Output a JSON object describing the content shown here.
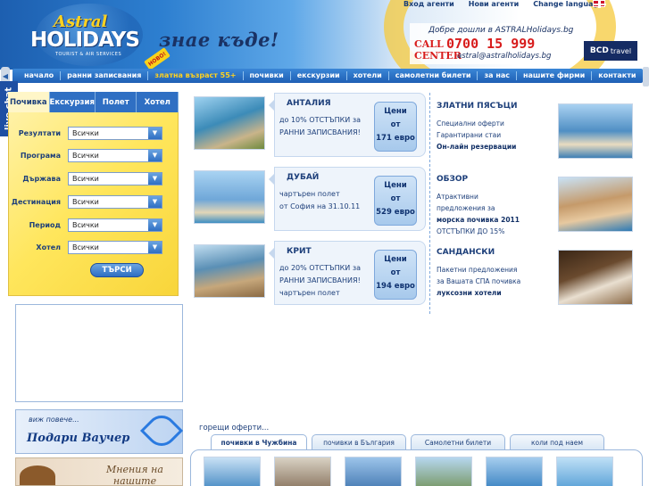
{
  "header": {
    "logo_astral": "Astral",
    "logo_holidays": "HOLIDAYS",
    "logo_sub": "TOURIST & AIR SERVICES",
    "slogan": "знае къде!",
    "new_badge": "НОВО!",
    "top_links": [
      "Вход агенти",
      "Нови агенти",
      "Change language"
    ],
    "welcome": "Добре дошли в ASTRALHolidays.bg",
    "call_label_1": "CALL",
    "call_label_2": "CENTER",
    "phone": "0700 15 999",
    "email": "astral@astralholidays.bg",
    "partner_logo": "BCD",
    "partner_logo_sub": "travel"
  },
  "nav": {
    "items": [
      "начало",
      "ранни записвания",
      "златна възраст 55+",
      "почивки",
      "екскурзии",
      "хотели",
      "самолетни билети",
      "за нас",
      "нашите фирми",
      "контакти"
    ],
    "highlighted_index": 2
  },
  "live_chat": "live chat",
  "search": {
    "tabs": [
      "Почивка",
      "Екскурзия",
      "Полет",
      "Хотел"
    ],
    "active_tab": 0,
    "fields": [
      {
        "label": "Резултати",
        "value": "Всички"
      },
      {
        "label": "Програма",
        "value": "Всички"
      },
      {
        "label": "Държава",
        "value": "Всички"
      },
      {
        "label": "Дестинация",
        "value": "Всички"
      },
      {
        "label": "Период",
        "value": "Всички"
      },
      {
        "label": "Хотел",
        "value": "Всички"
      }
    ],
    "button": "ТЪРСИ"
  },
  "offers": [
    {
      "title": "АНТАЛИЯ",
      "line1": "до 10% ОТСТЪПКИ за",
      "line2": "РАННИ ЗАПИСВАНИЯ!",
      "price_label": "Цени",
      "price_from": "от",
      "price": "171 евро",
      "photo_color": "#3c8bb8"
    },
    {
      "title": "ДУБАЙ",
      "line1": "чартърен полет",
      "line2": "от София на 31.10.11",
      "price_label": "Цени",
      "price_from": "от",
      "price": "529 евро",
      "photo_color": "#6fa7d8"
    },
    {
      "title": "КРИТ",
      "line1": "до 20% ОТСТЪПКИ за",
      "line2": "РАННИ ЗАПИСВАНИЯ!",
      "line3": "чартърен полет",
      "price_label": "Цени",
      "price_from": "от",
      "price": "194 евро",
      "photo_color": "#5a8fb5"
    }
  ],
  "promos": [
    {
      "title": "ЗЛАТНИ ПЯСЪЦИ",
      "lines": [
        "Специални оферти",
        "Гарантирани стаи"
      ],
      "bold": "Он-лайн резервации",
      "photo_color": "#4f8fc4"
    },
    {
      "title": "ОБЗОР",
      "lines": [
        "Атрактивни",
        "предложения за"
      ],
      "bold": "морска почивка 2011",
      "extra": "ОТСТЪПКИ ДО 15%",
      "photo_color": "#c59a6a"
    },
    {
      "title": "САНДАНСКИ",
      "lines": [
        "Пакетни предложения",
        "за Вашата СПА почивка"
      ],
      "bold": "луксозни хотели",
      "photo_color": "#6a4a2e"
    }
  ],
  "voucher": {
    "small": "виж повече...",
    "big": "Подари Ваучер"
  },
  "clients": {
    "line1": "Мнения на",
    "line2": "нашите КЛИЕНТИ"
  },
  "hot": {
    "title": "горещи оферти...",
    "tabs": [
      "почивки в Чужбина",
      "почивки в България",
      "Самолетни билети",
      "коли под наем"
    ],
    "active_tab": 0,
    "thumb_colors": [
      "#4e8fc6",
      "#8f7b66",
      "#4b7fb6",
      "#7a9a6a",
      "#3f86c4",
      "#5da3d8"
    ]
  }
}
